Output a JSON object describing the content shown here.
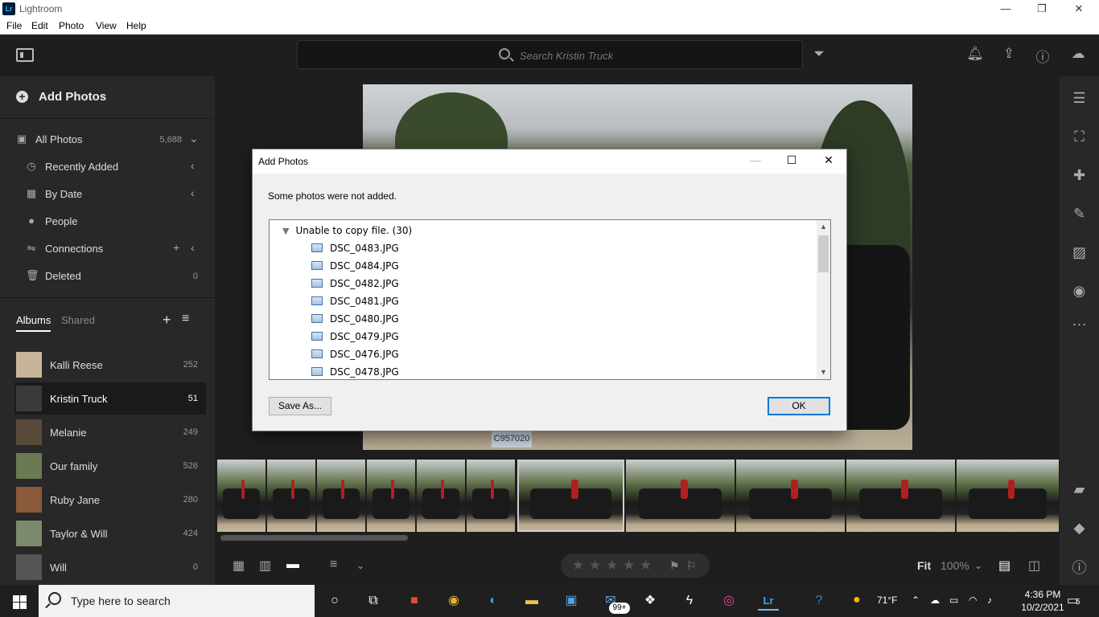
{
  "window": {
    "app_logo": "Lr",
    "title": "Lightroom",
    "minimize": "—",
    "maximize": "❐",
    "close": "✕"
  },
  "menu": [
    "File",
    "Edit",
    "Photo",
    "View",
    "Help"
  ],
  "search": {
    "placeholder": "Search Kristin Truck"
  },
  "sidebar": {
    "add_photos": "Add Photos",
    "nav": [
      {
        "label": "All Photos",
        "count": "5,688",
        "icon": "photos-icon"
      },
      {
        "label": "Recently Added",
        "icon": "clock-icon"
      },
      {
        "label": "By Date",
        "icon": "calendar-icon"
      },
      {
        "label": "People",
        "icon": "person-icon"
      },
      {
        "label": "Connections",
        "icon": "connections-icon"
      },
      {
        "label": "Deleted",
        "count": "0",
        "icon": "trash-icon"
      }
    ],
    "tabs": {
      "albums": "Albums",
      "shared": "Shared"
    },
    "albums": [
      {
        "name": "Kalli Reese",
        "count": "252",
        "color": "#c9b49a"
      },
      {
        "name": "Kristin Truck",
        "count": "51",
        "color": "#3a3a3a"
      },
      {
        "name": "Melanie",
        "count": "249",
        "color": "#5a4a3a"
      },
      {
        "name": "Our family",
        "count": "526",
        "color": "#6b7a55"
      },
      {
        "name": "Ruby Jane",
        "count": "280",
        "color": "#8a5a3a"
      },
      {
        "name": "Taylor & Will",
        "count": "424",
        "color": "#7a8a6a"
      },
      {
        "name": "Will",
        "count": "0",
        "color": "#555555"
      }
    ]
  },
  "photo": {
    "plate": "C957020"
  },
  "bottombar": {
    "fit": "Fit",
    "zoom": "100%"
  },
  "dialog": {
    "title": "Add Photos",
    "minimize": "—",
    "maximize": "☐",
    "close": "✕",
    "message": "Some photos were not added.",
    "group": "Unable to copy file. (30)",
    "files": [
      "DSC_0483.JPG",
      "DSC_0484.JPG",
      "DSC_0482.JPG",
      "DSC_0481.JPG",
      "DSC_0480.JPG",
      "DSC_0479.JPG",
      "DSC_0476.JPG",
      "DSC_0478.JPG"
    ],
    "save_as": "Save As...",
    "ok": "OK"
  },
  "taskbar": {
    "search_text": "Type here to search",
    "badge": "99+",
    "weather": "71°F",
    "time": "4:36 PM",
    "date": "10/2/2021",
    "notifications": "5"
  }
}
